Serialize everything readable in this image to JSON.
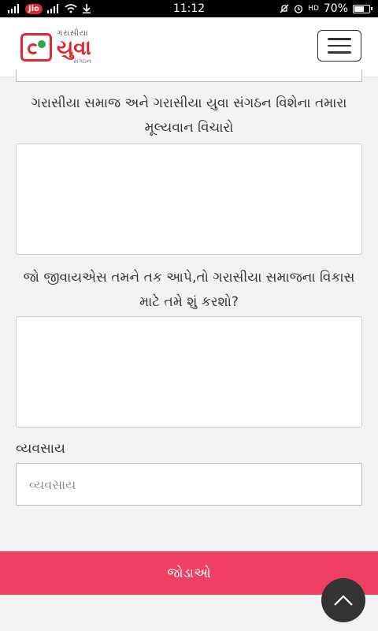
{
  "status_bar": {
    "carrier": "Jio",
    "time": "11:12",
    "battery_percent": "70%",
    "battery_level": 0.7,
    "volte": "HD"
  },
  "header": {
    "logo_top": "ગરાસીયા",
    "logo_main": "યુવા",
    "logo_bottom": "સંગઠન",
    "menu_icon": "hamburger-icon"
  },
  "form": {
    "question_1": "ગરાસીયા સમાજ અને ગરાસીયા યુવા સંગઠન વિશેના તમારા મૂલ્યવાન વિચારો",
    "question_1_value": "",
    "question_2": "જો જીવાયએસ તમને તક આપે,તો ગરાસીયા સમાજના વિકાસ માટે તમે શું કરશો?",
    "question_2_value": "",
    "occupation_label": "વ્યવસાય",
    "occupation_placeholder": "વ્યવસાય",
    "occupation_value": "",
    "submit_label": "જોડાઓ"
  },
  "scroll_top": {
    "icon": "chevron-up-icon"
  },
  "colors": {
    "submit_bg": "#ef3f62",
    "brand_red": "#e3262e",
    "scroll_top_bg": "#333333"
  }
}
